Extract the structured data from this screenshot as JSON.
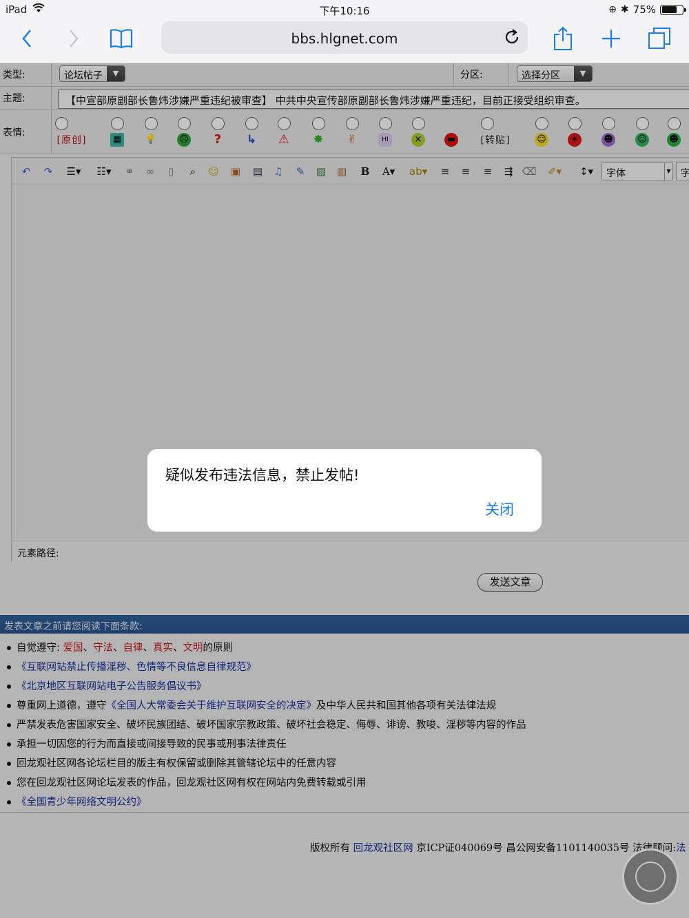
{
  "statusbar": {
    "device": "iPad",
    "time": "下午10:16",
    "battery": "75%",
    "battery_level": 0.75
  },
  "browser": {
    "url": "bbs.hlgnet.com"
  },
  "form": {
    "type_label": "类型:",
    "type_value": "论坛帖子",
    "section_label": "分区:",
    "section_value": "选择分区",
    "subject_label": "主题:",
    "subject_value": "【中宣部原副部长鲁炜涉嫌严重违纪被审查】 中共中央宣传部原副部长鲁炜涉嫌严重违纪，目前正接受组织审查。",
    "emotion_label": "表情:",
    "emotions": [
      {
        "text": "[原创]"
      },
      {
        "icon": "note"
      },
      {
        "icon": "bulb"
      },
      {
        "icon": "sad-green"
      },
      {
        "icon": "question"
      },
      {
        "icon": "arrow"
      },
      {
        "icon": "warning"
      },
      {
        "icon": "star"
      },
      {
        "icon": "thumb"
      },
      {
        "icon": "hi"
      },
      {
        "icon": "sick"
      },
      {
        "icon": "cool"
      },
      {
        "text": "[转贴]"
      },
      {
        "icon": "smile"
      },
      {
        "icon": "angry"
      },
      {
        "icon": "purple"
      },
      {
        "icon": "grin"
      },
      {
        "icon": "green"
      }
    ],
    "font_select": "字体",
    "font_size_select": "字",
    "element_path_label": "元素路径:",
    "send_button": "发送文章"
  },
  "terms": {
    "heading": "发表文章之前请您阅读下面条款:",
    "item1_prefix": "自觉遵守:",
    "item1_words": [
      "爱国",
      "守法",
      "自律",
      "真实",
      "文明"
    ],
    "item1_suffix": "的原则",
    "item2": "《互联网站禁止传播淫秽、色情等不良信息自律规范》",
    "item3": "《北京地区互联网站电子公告服务倡议书》",
    "item4_prefix": "尊重网上道德，遵守",
    "item4_link": "《全国人大常委会关于维护互联网安全的决定》",
    "item4_suffix": "及中华人民共和国其他各项有关法律法规",
    "item5": "严禁发表危害国家安全、破坏民族团结、破坏国家宗教政策、破坏社会稳定、侮辱、诽谤、教唆、淫秽等内容的作品",
    "item6": "承担一切因您的行为而直接或间接导致的民事或刑事法律责任",
    "item7": "回龙观社区网各论坛栏目的版主有权保留或删除其管辖论坛中的任意内容",
    "item8": "您在回龙观社区网论坛发表的作品，回龙观社区网有权在网站内免费转载或引用",
    "item9": "《全国青少年网络文明公约》"
  },
  "footer": {
    "copyright_prefix": "版权所有",
    "site_name": "回龙观社区网",
    "icp": "京ICP证040069号 昌公网安备1101140035号 法律顾问:",
    "lawyer_link": "法"
  },
  "alert": {
    "message": "疑似发布违法信息，禁止发帖!",
    "close_label": "关闭"
  }
}
